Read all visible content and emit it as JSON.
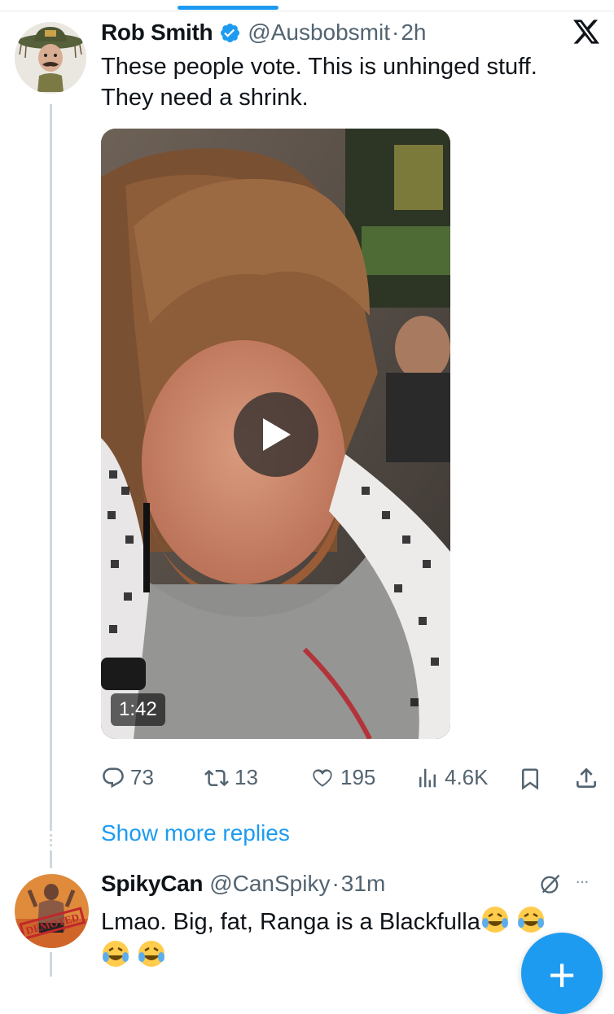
{
  "main_tweet": {
    "author_name": "Rob Smith",
    "handle": "@Ausbobsmit",
    "separator": "·",
    "time": "2h",
    "text_line1": "These people vote. This is unhinged stuff.",
    "text_line2": "They need a shrink.",
    "video": {
      "duration": "1:42"
    },
    "stats": {
      "replies": "73",
      "reposts": "13",
      "likes": "195",
      "views": "4.6K"
    }
  },
  "show_more_replies": "Show more replies",
  "reply_tweet": {
    "author_name": "SpikyCan",
    "handle": "@CanSpiky",
    "separator": "·",
    "time": "31m",
    "text": "Lmao. Big, fat, Ranga is a Blackfulla",
    "more_label": "···"
  },
  "fab_label": "+",
  "colors": {
    "accent": "#1d9bf0",
    "text_primary": "#0f1419",
    "text_secondary": "#536471",
    "divider": "#cfd9de"
  },
  "icons": [
    "verified-badge-icon",
    "x-logo-icon",
    "play-icon",
    "reply-icon",
    "repost-icon",
    "like-icon",
    "views-icon",
    "bookmark-icon",
    "share-icon",
    "grok-icon",
    "more-icon",
    "compose-plus-icon",
    "laughing-emoji-icon"
  ]
}
